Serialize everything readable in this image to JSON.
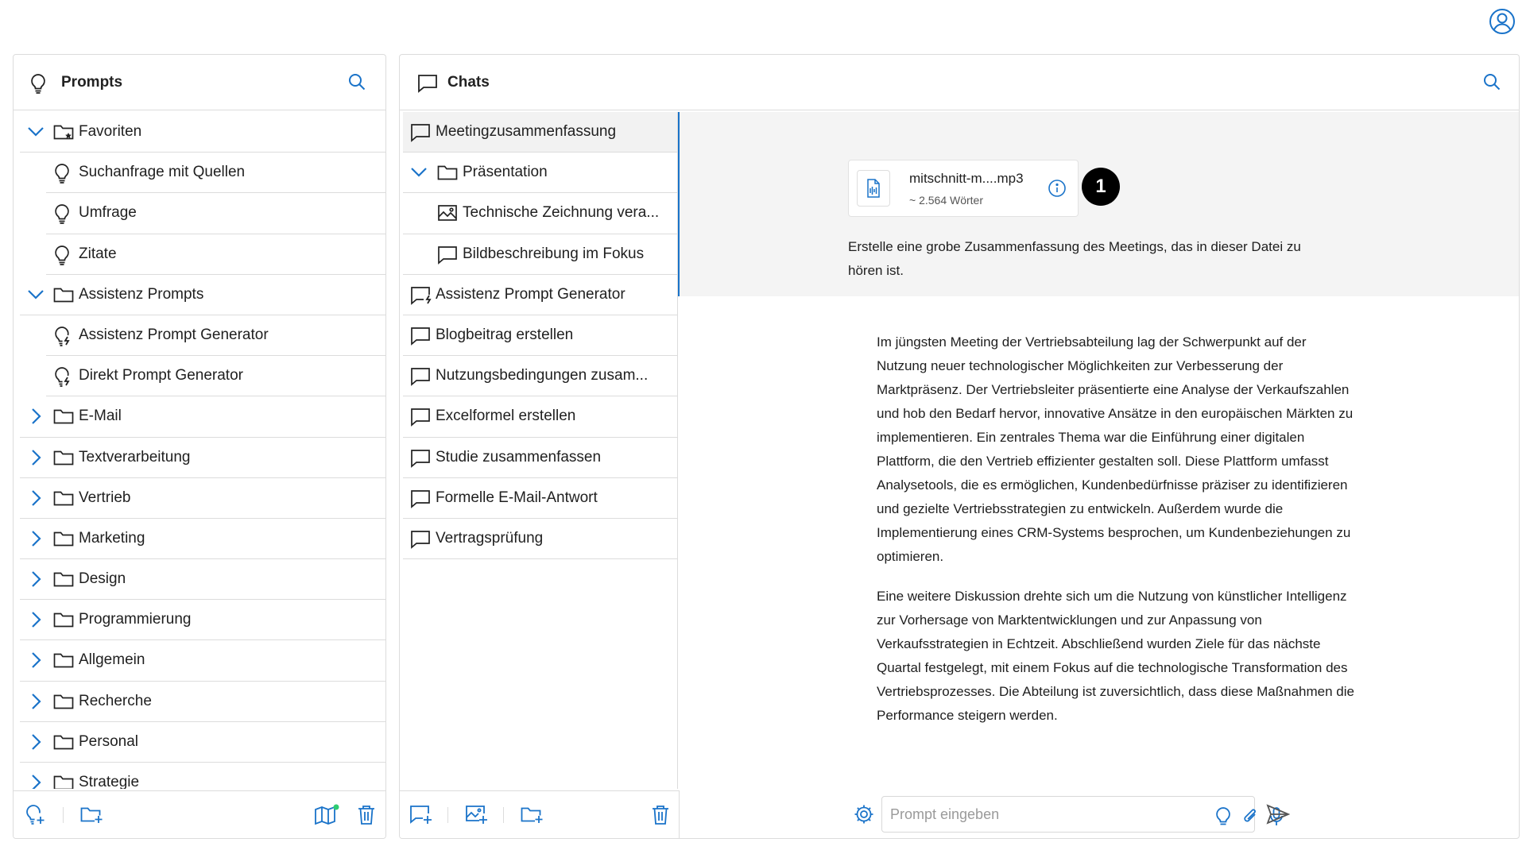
{
  "colors": {
    "accent": "#1a73c9",
    "border": "#dcdcdc",
    "selected_bg": "#f2f2f2",
    "message_bg": "#f4f4f4",
    "notification_dot": "#2ecc71"
  },
  "user_button": {
    "icon": "user-circle-icon"
  },
  "prompts": {
    "title": "Prompts",
    "header_icon": "lightbulb-icon",
    "search_icon": "search-icon",
    "tree": [
      {
        "type": "folder",
        "label": "Favoriten",
        "expanded": true,
        "icon": "star-folder-icon"
      },
      {
        "type": "prompt",
        "label": "Suchanfrage mit Quellen",
        "icon": "lightbulb-icon"
      },
      {
        "type": "prompt",
        "label": "Umfrage",
        "icon": "lightbulb-icon"
      },
      {
        "type": "prompt",
        "label": "Zitate",
        "icon": "lightbulb-icon"
      },
      {
        "type": "folder",
        "label": "Assistenz Prompts",
        "expanded": true,
        "icon": "folder-icon"
      },
      {
        "type": "prompt",
        "label": "Assistenz Prompt Generator",
        "icon": "lightbulb-bolt-icon"
      },
      {
        "type": "prompt",
        "label": "Direkt Prompt Generator",
        "icon": "lightbulb-bolt-icon"
      },
      {
        "type": "folder",
        "label": "E-Mail",
        "expanded": false,
        "icon": "folder-icon"
      },
      {
        "type": "folder",
        "label": "Textverarbeitung",
        "expanded": false,
        "icon": "folder-icon"
      },
      {
        "type": "folder",
        "label": "Vertrieb",
        "expanded": false,
        "icon": "folder-icon"
      },
      {
        "type": "folder",
        "label": "Marketing",
        "expanded": false,
        "icon": "folder-icon"
      },
      {
        "type": "folder",
        "label": "Design",
        "expanded": false,
        "icon": "folder-icon"
      },
      {
        "type": "folder",
        "label": "Programmierung",
        "expanded": false,
        "icon": "folder-icon"
      },
      {
        "type": "folder",
        "label": "Allgemein",
        "expanded": false,
        "icon": "folder-icon"
      },
      {
        "type": "folder",
        "label": "Recherche",
        "expanded": false,
        "icon": "folder-icon"
      },
      {
        "type": "folder",
        "label": "Personal",
        "expanded": false,
        "icon": "folder-icon"
      },
      {
        "type": "folder",
        "label": "Strategie",
        "expanded": false,
        "icon": "folder-icon"
      }
    ],
    "footer": [
      "add-prompt-icon",
      "add-folder-icon",
      "prompt-library-icon",
      "trash-icon"
    ]
  },
  "chats": {
    "title": "Chats",
    "header_icon": "chat-bubble-icon",
    "search_icon": "search-icon",
    "list": [
      {
        "type": "chat",
        "label": "Meetingzusammenfassung",
        "selected": true,
        "icon": "chat-bubble-icon"
      },
      {
        "type": "folder",
        "label": "Präsentation",
        "expanded": true,
        "icon": "folder-icon"
      },
      {
        "type": "chat",
        "label": "Technische Zeichnung vera...",
        "sub": true,
        "icon": "image-icon"
      },
      {
        "type": "chat",
        "label": "Bildbeschreibung im Fokus",
        "sub": true,
        "icon": "chat-bubble-icon"
      },
      {
        "type": "chat",
        "label": "Assistenz Prompt Generator",
        "icon": "chat-bolt-icon"
      },
      {
        "type": "chat",
        "label": "Blogbeitrag erstellen",
        "icon": "chat-bubble-icon"
      },
      {
        "type": "chat",
        "label": "Nutzungsbedingungen zusam...",
        "icon": "chat-bubble-icon"
      },
      {
        "type": "chat",
        "label": "Excelformel erstellen",
        "icon": "chat-bubble-icon"
      },
      {
        "type": "chat",
        "label": "Studie zusammenfassen",
        "icon": "chat-bubble-icon"
      },
      {
        "type": "chat",
        "label": "Formelle E-Mail-Antwort",
        "icon": "chat-bubble-icon"
      },
      {
        "type": "chat",
        "label": "Vertragsprüfung",
        "icon": "chat-bubble-icon"
      }
    ],
    "footer": [
      "new-chat-icon",
      "new-image-chat-icon",
      "new-chat-folder-icon",
      "trash-icon"
    ]
  },
  "conversation": {
    "file": {
      "name": "mitschnitt-m....mp3",
      "words": "~ 2.564 Wörter",
      "icon": "audio-file-icon",
      "info_icon": "info-icon"
    },
    "callout": "1",
    "user_message": "Erstelle eine grobe Zusammenfassung des Meetings, das in dieser Datei zu hören ist.",
    "assistant_paragraphs": [
      "Im jüngsten Meeting der Vertriebsabteilung lag der Schwerpunkt auf der Nutzung neuer technologischer Möglichkeiten zur Verbesserung der Marktpräsenz. Der Vertriebsleiter präsentierte eine Analyse der Verkaufszahlen und hob den Bedarf hervor, innovative Ansätze in den europäischen Märkten zu implementieren. Ein zentrales Thema war die Einführung einer digitalen Plattform, die den Vertrieb effizienter gestalten soll. Diese Plattform umfasst Analysetools, die es ermöglichen, Kundenbedürfnisse präziser zu identifizieren und gezielte Vertriebsstrategien zu entwickeln. Außerdem wurde die Implementierung eines CRM-Systems besprochen, um Kundenbeziehungen zu optimieren.",
      "Eine weitere Diskussion drehte sich um die Nutzung von künstlicher Intelligenz zur Vorhersage von Marktentwicklungen und zur Anpassung von Verkaufsstrategien in Echtzeit. Abschließend wurden Ziele für das nächste Quartal festgelegt, mit einem Fokus auf die technologische Transformation des Vertriebsprozesses. Die Abteilung ist zuversichtlich, dass diese Maßnahmen die Performance steigern werden."
    ]
  },
  "input": {
    "placeholder": "Prompt eingeben",
    "value": "",
    "icons": [
      "settings-gear-icon",
      "lightbulb-icon",
      "paperclip-icon",
      "microphone-icon",
      "send-icon"
    ]
  }
}
